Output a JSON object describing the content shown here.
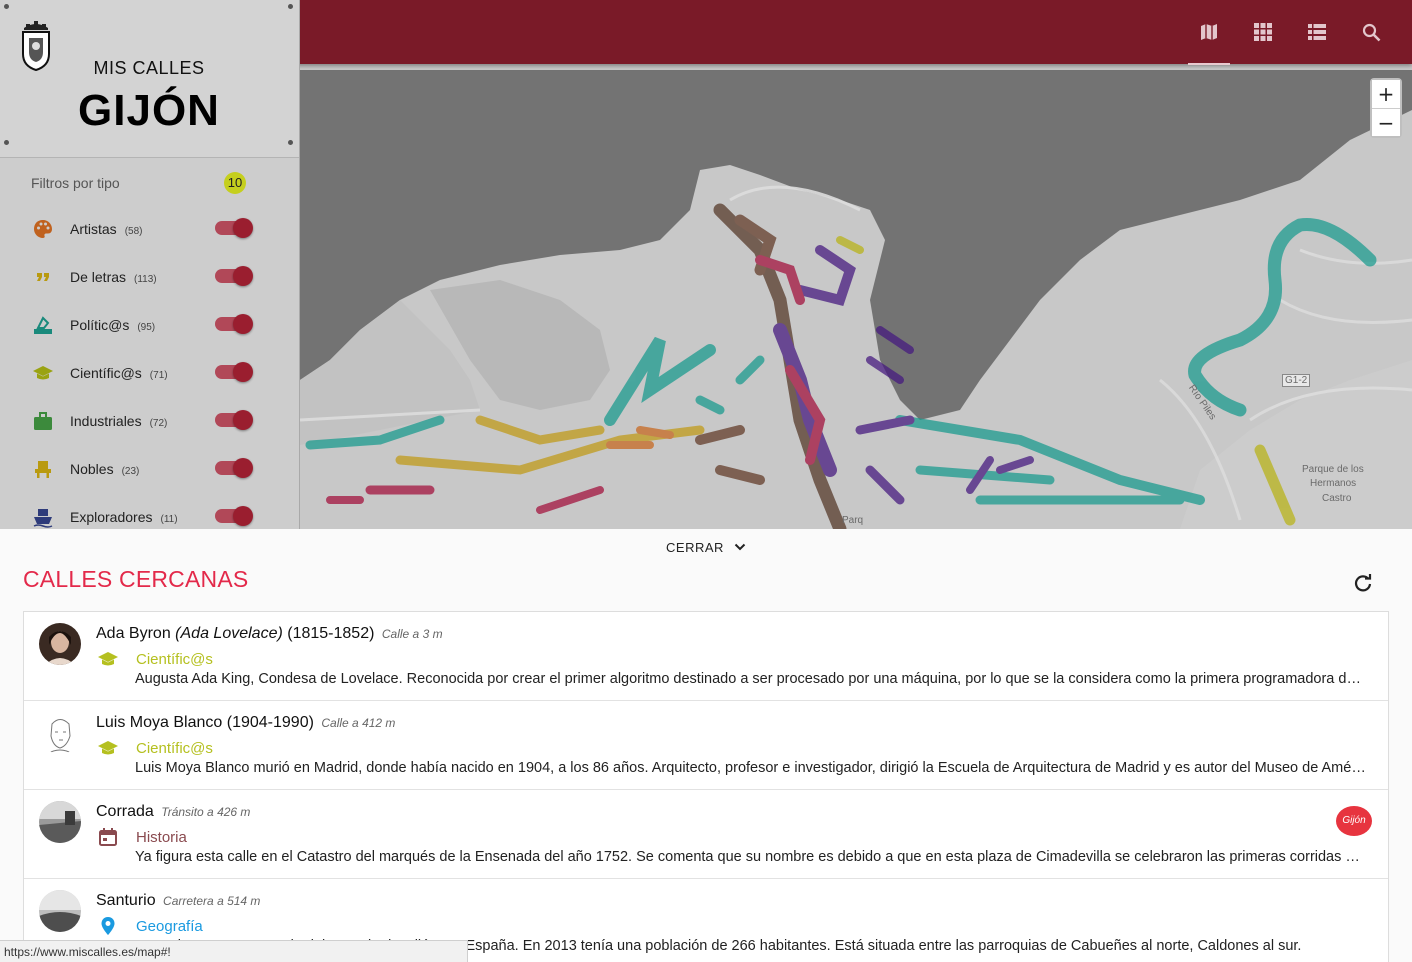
{
  "app": {
    "brand_line1": "MIS CALLES",
    "brand_line2": "GIJÓN",
    "accent": "#7a1a28",
    "icons": [
      "coat-of-arms-icon",
      "map-view-icon",
      "grid-view-icon",
      "list-view-icon",
      "search-icon"
    ]
  },
  "map": {
    "zoom_in": "+",
    "zoom_out": "−",
    "labels": {
      "river": "Río Piles",
      "road": "G1-2",
      "park_1": "Parque de los",
      "park_2": "Hermanos",
      "park_3": "Castro",
      "fragment": "Parq"
    }
  },
  "filters": {
    "heading": "Filtros por tipo",
    "active_count": "10",
    "items": [
      {
        "label": "Artistas",
        "count": "(58)",
        "icon": "palette-icon",
        "color": "#c0621f"
      },
      {
        "label": "De letras",
        "count": "(113)",
        "icon": "quote-icon",
        "color": "#b99a10"
      },
      {
        "label": "Polític@s",
        "count": "(95)",
        "icon": "ballot-icon",
        "color": "#1a8a7c"
      },
      {
        "label": "Científic@s",
        "count": "(71)",
        "icon": "graduation-cap-icon",
        "color": "#9aa312"
      },
      {
        "label": "Industriales",
        "count": "(72)",
        "icon": "briefcase-icon",
        "color": "#3c8a3c"
      },
      {
        "label": "Nobles",
        "count": "(23)",
        "icon": "throne-icon",
        "color": "#b99a10"
      },
      {
        "label": "Exploradores",
        "count": "(11)",
        "icon": "ship-icon",
        "color": "#2e3b7a"
      }
    ]
  },
  "panel": {
    "close_label": "CERRAR",
    "section_title": "CALLES CERCANAS",
    "items": [
      {
        "name": "Ada Byron",
        "alias": "(Ada Lovelace)",
        "years": "(1815-1852)",
        "distance": "Calle a 3 m",
        "category": "Científic@s",
        "category_color": "#b5c020",
        "description": "Augusta Ada King, Condesa de Lovelace. Reconocida por crear el primer algoritmo destinado a ser procesado por una máquina, por lo que se la considera como la primera programadora de la historia."
      },
      {
        "name": "Luis Moya Blanco",
        "years": "(1904-1990)",
        "distance": "Calle a 412 m",
        "category": "Científic@s",
        "category_color": "#b5c020",
        "description": "Luis Moya Blanco murió en Madrid, donde había nacido en 1904, a los 86 años. Arquitecto, profesor e investigador, dirigió la Escuela de Arquitectura de Madrid y es autor del Museo de América."
      },
      {
        "name": "Corrada",
        "distance": "Tránsito a 426 m",
        "category": "Historia",
        "category_color": "#8a4a4f",
        "badge": "Gijón",
        "description": "Ya figura esta calle en el Catastro del marqués de la Ensenada del año 1752. Se comenta que su nombre es debido a que en esta plaza de Cimadevilla se celebraron las primeras corridas de toros."
      },
      {
        "name": "Santurio",
        "distance": "Carretera a 514 m",
        "category": "Geografía",
        "category_color": "#1a9ae0",
        "description": "Santurio es una parroquia del concejo de Gijón, en España. En 2013 tenía una población de 266 habitantes. Está situada entre las parroquias de Cabueñes al norte, Caldones al sur."
      }
    ]
  },
  "status_url": "https://www.miscalles.es/map#!"
}
